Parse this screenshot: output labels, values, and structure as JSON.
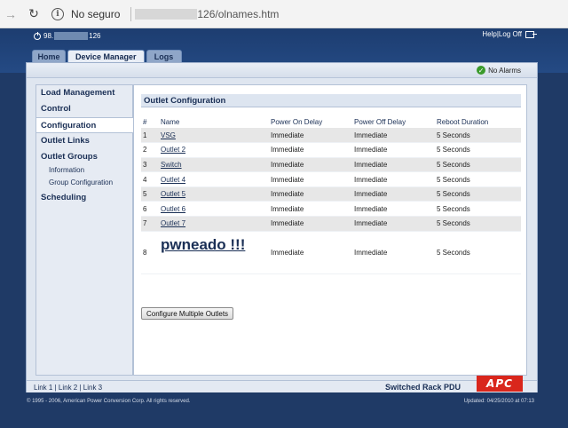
{
  "browser": {
    "security_label": "No seguro",
    "url_suffix": "126/olnames.htm"
  },
  "header": {
    "ip_prefix": "98.",
    "ip_suffix": "126",
    "help_label": "Help",
    "link_sep": " | ",
    "logoff_label": "Log Off"
  },
  "tabs": [
    {
      "label": "Home"
    },
    {
      "label": "Device Manager"
    },
    {
      "label": "Logs"
    }
  ],
  "status": {
    "alarms_label": "No Alarms"
  },
  "sidebar": {
    "items": [
      {
        "label": "Load Management"
      },
      {
        "label": "Control"
      },
      {
        "label": "Configuration"
      },
      {
        "label": "Outlet Links"
      },
      {
        "label": "Outlet Groups"
      },
      {
        "label": "Information"
      },
      {
        "label": "Group Configuration"
      },
      {
        "label": "Scheduling"
      }
    ]
  },
  "content": {
    "title": "Outlet Configuration",
    "columns": [
      "#",
      "Name",
      "Power On Delay",
      "Power Off Delay",
      "Reboot Duration"
    ],
    "rows": [
      {
        "num": "1",
        "name": "VSG",
        "on": "Immediate",
        "off": "Immediate",
        "reboot": "5 Seconds"
      },
      {
        "num": "2",
        "name": "Outlet 2",
        "on": "Immediate",
        "off": "Immediate",
        "reboot": "5 Seconds"
      },
      {
        "num": "3",
        "name": "Switch",
        "on": "Immediate",
        "off": "Immediate",
        "reboot": "5 Seconds"
      },
      {
        "num": "4",
        "name": "Outlet 4",
        "on": "Immediate",
        "off": "Immediate",
        "reboot": "5 Seconds"
      },
      {
        "num": "5",
        "name": "Outlet 5",
        "on": "Immediate",
        "off": "Immediate",
        "reboot": "5 Seconds"
      },
      {
        "num": "6",
        "name": "Outlet 6",
        "on": "Immediate",
        "off": "Immediate",
        "reboot": "5 Seconds"
      },
      {
        "num": "7",
        "name": "Outlet 7",
        "on": "Immediate",
        "off": "Immediate",
        "reboot": "5 Seconds"
      },
      {
        "num": "8",
        "name": "pwneado !!!",
        "on": "Immediate",
        "off": "Immediate",
        "reboot": "5 Seconds"
      }
    ],
    "button_label": "Configure Multiple Outlets"
  },
  "footer": {
    "link1": "Link 1",
    "link2": "Link 2",
    "link3": "Link 3",
    "sep": " | ",
    "product": "Switched Rack PDU",
    "logo_text": "APC",
    "copyright": "© 1995 - 2006, American Power Conversion Corp. All rights reserved.",
    "updated": "Updated: 04/25/2010 at 07:13"
  },
  "colors": {
    "frame_bg": "#1f3a66",
    "logo_red": "#d9261c",
    "ok_green": "#3a9a2b"
  }
}
